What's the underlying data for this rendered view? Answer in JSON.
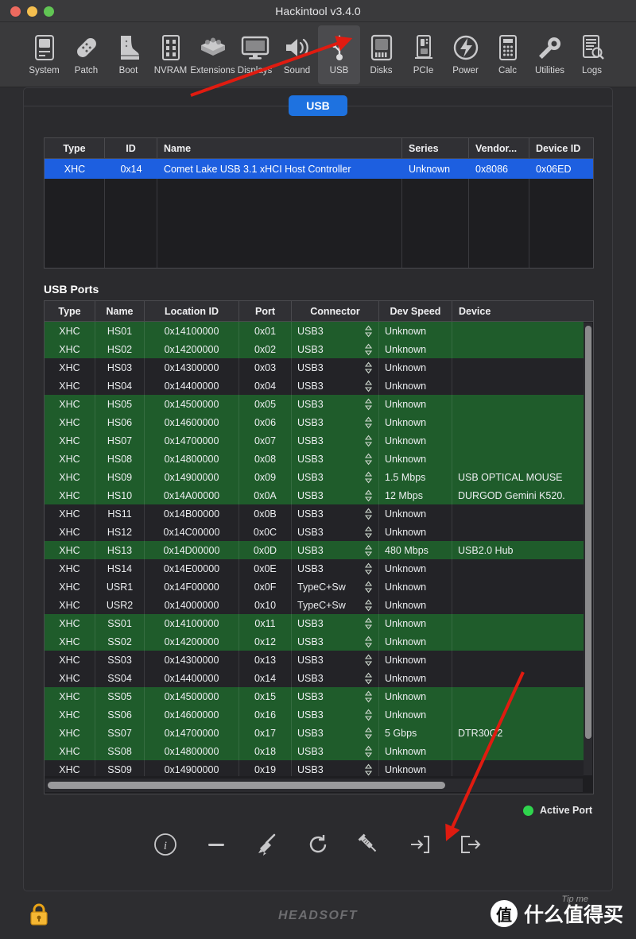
{
  "window": {
    "title": "Hackintool v3.4.0",
    "traffic_lights": [
      "close-red",
      "minimize-yellow",
      "zoom-green"
    ]
  },
  "toolbar": {
    "items": [
      {
        "label": "System",
        "icon": "system-icon",
        "active": false
      },
      {
        "label": "Patch",
        "icon": "patch-icon",
        "active": false
      },
      {
        "label": "Boot",
        "icon": "boot-icon",
        "active": false
      },
      {
        "label": "NVRAM",
        "icon": "nvram-icon",
        "active": false
      },
      {
        "label": "Extensions",
        "icon": "extensions-icon",
        "active": false
      },
      {
        "label": "Displays",
        "icon": "displays-icon",
        "active": false
      },
      {
        "label": "Sound",
        "icon": "sound-icon",
        "active": false
      },
      {
        "label": "USB",
        "icon": "usb-icon",
        "active": true
      },
      {
        "label": "Disks",
        "icon": "disks-icon",
        "active": false
      },
      {
        "label": "PCIe",
        "icon": "pcie-icon",
        "active": false
      },
      {
        "label": "Power",
        "icon": "power-icon",
        "active": false
      },
      {
        "label": "Calc",
        "icon": "calc-icon",
        "active": false
      },
      {
        "label": "Utilities",
        "icon": "utilities-icon",
        "active": false
      },
      {
        "label": "Logs",
        "icon": "logs-icon",
        "active": false
      }
    ]
  },
  "tab": {
    "label": "USB"
  },
  "controllers": {
    "columns": [
      "Type",
      "ID",
      "Name",
      "Series",
      "Vendor...",
      "Device ID"
    ],
    "rows": [
      {
        "type": "XHC",
        "id": "0x14",
        "name": "Comet Lake USB 3.1 xHCI Host Controller",
        "series": "Unknown",
        "vendor": "0x8086",
        "device_id": "0x06ED",
        "selected": true
      }
    ]
  },
  "ports_section": {
    "title": "USB Ports",
    "columns": [
      "Type",
      "Name",
      "Location ID",
      "Port",
      "Connector",
      "Dev Speed",
      "Device"
    ],
    "rows": [
      {
        "type": "XHC",
        "name": "HS01",
        "location_id": "0x14100000",
        "port": "0x01",
        "connector": "USB3",
        "speed": "Unknown",
        "device": "",
        "active": true
      },
      {
        "type": "XHC",
        "name": "HS02",
        "location_id": "0x14200000",
        "port": "0x02",
        "connector": "USB3",
        "speed": "Unknown",
        "device": "",
        "active": true
      },
      {
        "type": "XHC",
        "name": "HS03",
        "location_id": "0x14300000",
        "port": "0x03",
        "connector": "USB3",
        "speed": "Unknown",
        "device": "",
        "active": false
      },
      {
        "type": "XHC",
        "name": "HS04",
        "location_id": "0x14400000",
        "port": "0x04",
        "connector": "USB3",
        "speed": "Unknown",
        "device": "",
        "active": false
      },
      {
        "type": "XHC",
        "name": "HS05",
        "location_id": "0x14500000",
        "port": "0x05",
        "connector": "USB3",
        "speed": "Unknown",
        "device": "",
        "active": true
      },
      {
        "type": "XHC",
        "name": "HS06",
        "location_id": "0x14600000",
        "port": "0x06",
        "connector": "USB3",
        "speed": "Unknown",
        "device": "",
        "active": true
      },
      {
        "type": "XHC",
        "name": "HS07",
        "location_id": "0x14700000",
        "port": "0x07",
        "connector": "USB3",
        "speed": "Unknown",
        "device": "",
        "active": true
      },
      {
        "type": "XHC",
        "name": "HS08",
        "location_id": "0x14800000",
        "port": "0x08",
        "connector": "USB3",
        "speed": "Unknown",
        "device": "",
        "active": true
      },
      {
        "type": "XHC",
        "name": "HS09",
        "location_id": "0x14900000",
        "port": "0x09",
        "connector": "USB3",
        "speed": "1.5 Mbps",
        "device": "USB OPTICAL MOUSE",
        "active": true
      },
      {
        "type": "XHC",
        "name": "HS10",
        "location_id": "0x14A00000",
        "port": "0x0A",
        "connector": "USB3",
        "speed": "12 Mbps",
        "device": "DURGOD Gemini K520.",
        "active": true
      },
      {
        "type": "XHC",
        "name": "HS11",
        "location_id": "0x14B00000",
        "port": "0x0B",
        "connector": "USB3",
        "speed": "Unknown",
        "device": "",
        "active": false
      },
      {
        "type": "XHC",
        "name": "HS12",
        "location_id": "0x14C00000",
        "port": "0x0C",
        "connector": "USB3",
        "speed": "Unknown",
        "device": "",
        "active": false
      },
      {
        "type": "XHC",
        "name": "HS13",
        "location_id": "0x14D00000",
        "port": "0x0D",
        "connector": "USB3",
        "speed": "480 Mbps",
        "device": "USB2.0 Hub",
        "active": true
      },
      {
        "type": "XHC",
        "name": "HS14",
        "location_id": "0x14E00000",
        "port": "0x0E",
        "connector": "USB3",
        "speed": "Unknown",
        "device": "",
        "active": false
      },
      {
        "type": "XHC",
        "name": "USR1",
        "location_id": "0x14F00000",
        "port": "0x0F",
        "connector": "TypeC+Sw",
        "speed": "Unknown",
        "device": "",
        "active": false
      },
      {
        "type": "XHC",
        "name": "USR2",
        "location_id": "0x14000000",
        "port": "0x10",
        "connector": "TypeC+Sw",
        "speed": "Unknown",
        "device": "",
        "active": false
      },
      {
        "type": "XHC",
        "name": "SS01",
        "location_id": "0x14100000",
        "port": "0x11",
        "connector": "USB3",
        "speed": "Unknown",
        "device": "",
        "active": true
      },
      {
        "type": "XHC",
        "name": "SS02",
        "location_id": "0x14200000",
        "port": "0x12",
        "connector": "USB3",
        "speed": "Unknown",
        "device": "",
        "active": true
      },
      {
        "type": "XHC",
        "name": "SS03",
        "location_id": "0x14300000",
        "port": "0x13",
        "connector": "USB3",
        "speed": "Unknown",
        "device": "",
        "active": false
      },
      {
        "type": "XHC",
        "name": "SS04",
        "location_id": "0x14400000",
        "port": "0x14",
        "connector": "USB3",
        "speed": "Unknown",
        "device": "",
        "active": false
      },
      {
        "type": "XHC",
        "name": "SS05",
        "location_id": "0x14500000",
        "port": "0x15",
        "connector": "USB3",
        "speed": "Unknown",
        "device": "",
        "active": true
      },
      {
        "type": "XHC",
        "name": "SS06",
        "location_id": "0x14600000",
        "port": "0x16",
        "connector": "USB3",
        "speed": "Unknown",
        "device": "",
        "active": true
      },
      {
        "type": "XHC",
        "name": "SS07",
        "location_id": "0x14700000",
        "port": "0x17",
        "connector": "USB3",
        "speed": "5 Gbps",
        "device": "DTR30G2",
        "active": true
      },
      {
        "type": "XHC",
        "name": "SS08",
        "location_id": "0x14800000",
        "port": "0x18",
        "connector": "USB3",
        "speed": "Unknown",
        "device": "",
        "active": true
      },
      {
        "type": "XHC",
        "name": "SS09",
        "location_id": "0x14900000",
        "port": "0x19",
        "connector": "USB3",
        "speed": "Unknown",
        "device": "",
        "active": false
      }
    ]
  },
  "legend": {
    "label": "Active Port",
    "color": "#2fd44d"
  },
  "actions": [
    {
      "name": "info-icon",
      "title": "Info"
    },
    {
      "name": "minus-icon",
      "title": "Remove"
    },
    {
      "name": "broom-icon",
      "title": "Clean"
    },
    {
      "name": "refresh-icon",
      "title": "Refresh"
    },
    {
      "name": "syringe-icon",
      "title": "Inject"
    },
    {
      "name": "import-icon",
      "title": "Import"
    },
    {
      "name": "export-icon",
      "title": "Export"
    }
  ],
  "footer": {
    "lock": "lock-icon",
    "brand": "HEADSOFT",
    "watermark_badge": "值",
    "watermark_text": "什么值得买",
    "watermark_tip": "Tip me"
  },
  "colors": {
    "accent_blue": "#1e72e0",
    "selection_blue": "#1d5fe0",
    "active_row_green": "#1f5c2b",
    "inactive_row": "#232327",
    "legend_green": "#2fd44d",
    "annotation_red": "#e01b10"
  }
}
